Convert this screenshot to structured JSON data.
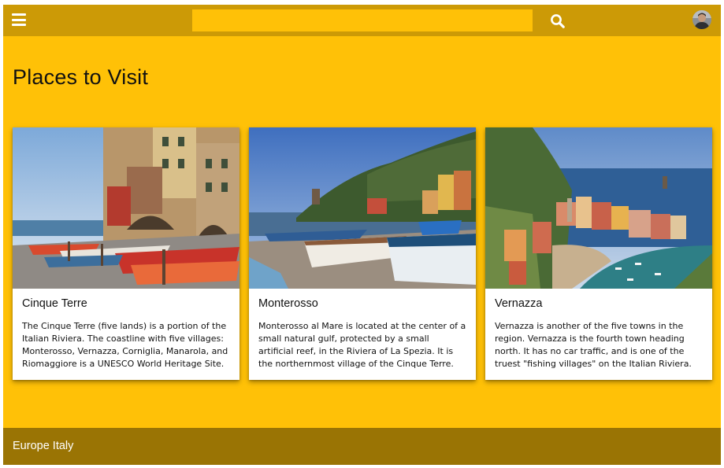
{
  "header": {
    "menu_icon": "hamburger-menu-icon",
    "search_placeholder": "",
    "search_value": "",
    "search_icon": "search-icon",
    "avatar_icon": "user-avatar"
  },
  "page": {
    "title": "Places to Visit"
  },
  "cards": [
    {
      "title": "Cinque Terre",
      "text": "The Cinque Terre (five lands) is a portion of the Italian Riviera. The coastline with five villages: Monterosso, Vernazza, Corniglia, Manarola, and Riomaggiore is a UNESCO World Heritage Site.",
      "image": "photo-boats-on-shore"
    },
    {
      "title": "Monterosso",
      "text": "Monterosso al Mare is located at the center of a small natural gulf, protected by a small artificial reef, in the Riviera of La Spezia. It is the northernmost village of the Cinque Terre.",
      "image": "photo-beach-boats-village"
    },
    {
      "title": "Vernazza",
      "text": "Vernazza is another of the five towns in the region. Vernazza is the fourth town heading north. It has no car traffic, and is one of the truest \"fishing villages\" on the Italian Riviera.",
      "image": "photo-coastal-village-harbor"
    }
  ],
  "footer": {
    "text": "Europe Italy"
  },
  "colors": {
    "topbar": "#cc9a06",
    "accent": "#ffc107",
    "footer": "#9a7404"
  }
}
